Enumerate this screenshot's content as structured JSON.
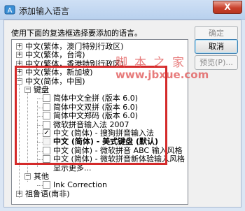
{
  "window": {
    "title": "添加输入语言",
    "close_glyph": "X"
  },
  "instruction": "使用下面的复选框选择要添加的语言。",
  "buttons": {
    "ok": "确定",
    "cancel": "取消",
    "preview": "预览(P)..."
  },
  "tree": [
    {
      "label": "中文(繁体，澳门特别行政区)",
      "level": 0,
      "expander": "+"
    },
    {
      "label": "中文(繁体，台湾)",
      "level": 0,
      "expander": "+"
    },
    {
      "label": "中文(繁体，香港特别行政区)",
      "level": 0,
      "expander": "+"
    },
    {
      "label": "中文(繁体，新加坡)",
      "level": 0,
      "expander": "+"
    },
    {
      "label": "中文(简体，中国)",
      "level": 0,
      "expander": "-"
    },
    {
      "label": "键盘",
      "level": 1,
      "expander": "-"
    },
    {
      "label": "简体中文全拼 (版本 6.0)",
      "level": 2,
      "checked": false,
      "bold": false
    },
    {
      "label": "简体中文双拼 (版本 6.0)",
      "level": 2,
      "checked": false,
      "bold": false
    },
    {
      "label": "简体中文郑码 (版本 6.0)",
      "level": 2,
      "checked": false,
      "bold": false
    },
    {
      "label": "微软拼音输入法 2007",
      "level": 2,
      "checked": false,
      "bold": false
    },
    {
      "label": "中文 (简体) - 搜狗拼音输入法",
      "level": 2,
      "checked": true,
      "bold": false
    },
    {
      "label": "中文 (简体) - 美式键盘 (默认)",
      "level": 2,
      "checked": false,
      "bold": true,
      "disabled": true
    },
    {
      "label": "中文 (简体) - 微软拼音 ABC 输入风格",
      "level": 2,
      "checked": false,
      "bold": false
    },
    {
      "label": "中文 (简体) - 微软拼音新体验输入风格",
      "level": 2,
      "checked": false,
      "bold": false
    },
    {
      "label": "显示更多...",
      "level": 2,
      "link": true
    },
    {
      "label": "其他",
      "level": 1,
      "expander": "-"
    },
    {
      "label": "Ink Correction",
      "level": 2,
      "checked": false,
      "bold": false
    },
    {
      "label": "祖鲁语(南非)",
      "level": 0,
      "expander": "+"
    }
  ],
  "watermark": {
    "line1": "脚本之家",
    "line2": "www.jbxue.com"
  },
  "colors": {
    "highlight_border": "#d42a2a",
    "titlebar": "#b9d1ee",
    "close_button": "#c9402c"
  }
}
